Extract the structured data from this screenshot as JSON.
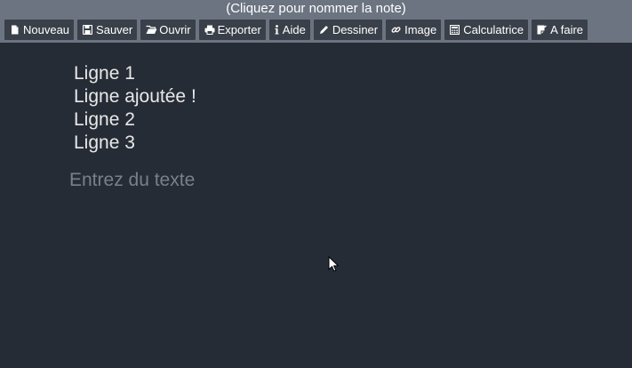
{
  "header": {
    "note_title": "(Cliquez pour nommer la note)"
  },
  "toolbar": {
    "buttons": [
      {
        "label": "Nouveau",
        "icon": "file-icon"
      },
      {
        "label": "Sauver",
        "icon": "save-icon"
      },
      {
        "label": "Ouvrir",
        "icon": "folder-open-icon"
      },
      {
        "label": "Exporter",
        "icon": "print-icon"
      },
      {
        "label": "Aide",
        "icon": "info-icon"
      },
      {
        "label": "Dessiner",
        "icon": "pencil-icon"
      },
      {
        "label": "Image",
        "icon": "link-icon"
      },
      {
        "label": "Calculatrice",
        "icon": "calculator-icon"
      },
      {
        "label": "A faire",
        "icon": "checklist-icon"
      }
    ]
  },
  "note": {
    "lines": [
      "Ligne 1",
      "Ligne ajoutée !",
      "Ligne 2",
      "Ligne 3"
    ]
  },
  "editor": {
    "placeholder": "Entrez du texte",
    "value": ""
  },
  "colors": {
    "background": "#262c36",
    "topbar": "#6b7480",
    "button": "#3a404a",
    "text": "#e8e8e8",
    "placeholder": "#7a808a"
  }
}
